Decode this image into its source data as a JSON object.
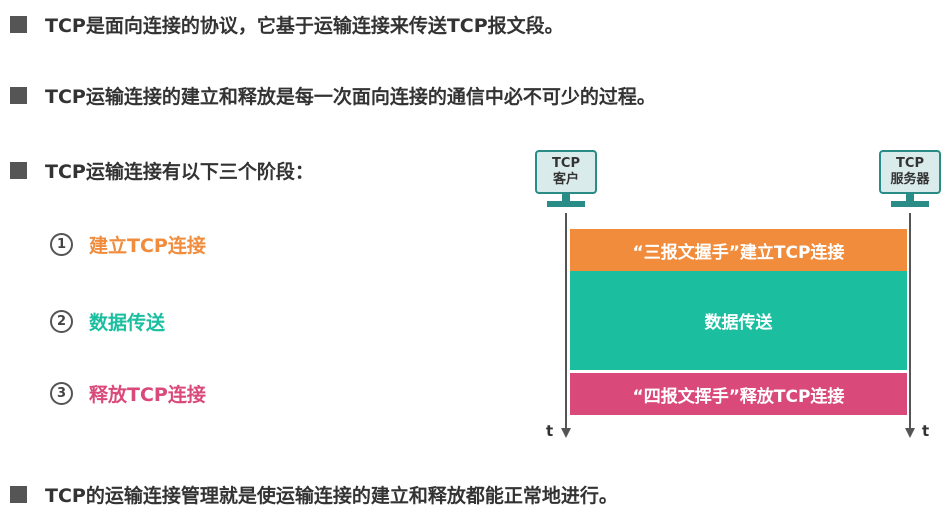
{
  "bullets": [
    "TCP是面向连接的协议，它基于运输连接来传送TCP报文段。",
    "TCP运输连接的建立和释放是每一次面向连接的通信中必不可少的过程。",
    "TCP运输连接有以下三个阶段：",
    "TCP的运输连接管理就是使运输连接的建立和释放都能正常地进行。"
  ],
  "stages": [
    {
      "num": "1",
      "label": "建立TCP连接",
      "color": "#f08c3c"
    },
    {
      "num": "2",
      "label": "数据传送",
      "color": "#1bbfa0"
    },
    {
      "num": "3",
      "label": "释放TCP连接",
      "color": "#d94a7a"
    }
  ],
  "diagram": {
    "client": {
      "line1": "TCP",
      "line2": "客户"
    },
    "server": {
      "line1": "TCP",
      "line2": "服务器"
    },
    "time_label": "t",
    "phases": [
      {
        "label": "“三报文握手”建立TCP连接",
        "color": "#f08c3c"
      },
      {
        "label": "数据传送",
        "color": "#1bbfa0"
      },
      {
        "label": "“四报文挥手”释放TCP连接",
        "color": "#d94a7a"
      }
    ]
  }
}
